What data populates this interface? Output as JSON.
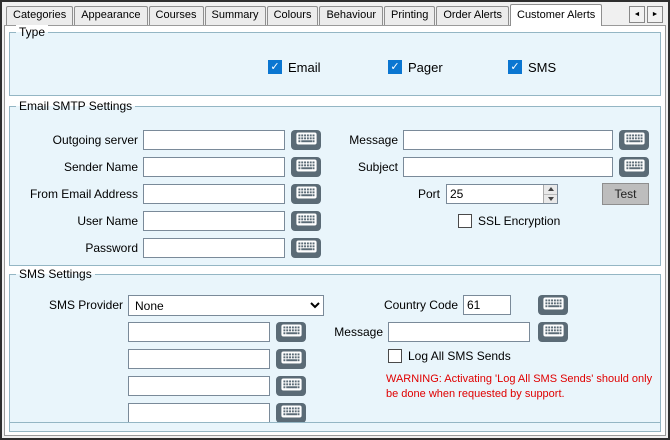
{
  "tabs": {
    "items": [
      "Categories",
      "Appearance",
      "Courses",
      "Summary",
      "Colours",
      "Behaviour",
      "Printing",
      "Order Alerts",
      "Customer Alerts"
    ],
    "selected": "Customer Alerts",
    "nav_prev": "◄",
    "nav_next": "►"
  },
  "type_group": {
    "title": "Type",
    "options": [
      {
        "label": "Email",
        "checked": true
      },
      {
        "label": "Pager",
        "checked": true
      },
      {
        "label": "SMS",
        "checked": true
      }
    ]
  },
  "smtp_group": {
    "title": "Email SMTP Settings",
    "left_fields": [
      "Outgoing server",
      "Sender Name",
      "From Email Address",
      "User Name",
      "Password"
    ],
    "right_fields": [
      "Message",
      "Subject"
    ],
    "port_label": "Port",
    "port_value": "25",
    "ssl_label": "SSL Encryption",
    "ssl_checked": false,
    "test_button": "Test"
  },
  "sms_group": {
    "title": "SMS Settings",
    "provider_label": "SMS Provider",
    "provider_value": "None",
    "country_code_label": "Country Code",
    "country_code_value": "61",
    "message_label": "Message",
    "log_checkbox_label": "Log All SMS Sends",
    "log_checked": false,
    "warning_text": "WARNING: Activating 'Log All SMS Sends' should only be done when requested by support."
  },
  "colors": {
    "group_bg": "#e9f5fb",
    "checkbox_accent": "#0b76d1",
    "keyboard_button": "#5b6b76",
    "warning": "#e00000"
  }
}
